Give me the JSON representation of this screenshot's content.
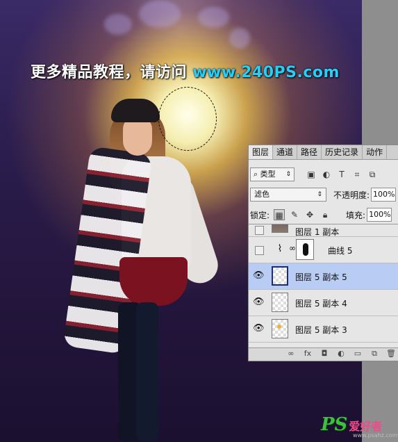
{
  "headline": {
    "text": "更多精品教程，请访问",
    "url": "www.240PS.com",
    "url_color": "#21d0ff"
  },
  "panel": {
    "tabs": [
      "图层",
      "通道",
      "路径",
      "历史记录",
      "动作"
    ],
    "active_tab": "图层",
    "kind_filter": "类型",
    "blend_mode": "滤色",
    "opacity_label": "不透明度:",
    "opacity_value": "100%",
    "lock_label": "锁定:",
    "fill_label": "填充:",
    "fill_value": "100%",
    "layers": [
      {
        "name": "图层 1 副本",
        "visible": false,
        "selected": false
      },
      {
        "name": "曲线 5",
        "visible": false,
        "selected": false,
        "type": "adjustment"
      },
      {
        "name": "图层 5 副本 5",
        "visible": true,
        "selected": true
      },
      {
        "name": "图层 5 副本 4",
        "visible": true,
        "selected": false
      },
      {
        "name": "图层 5 副本 3",
        "visible": true,
        "selected": false
      }
    ],
    "selected_color": "#b9cdf4"
  },
  "watermark": {
    "ps": "PS",
    "cn": "爱好者",
    "url": "www.psahz.com"
  }
}
